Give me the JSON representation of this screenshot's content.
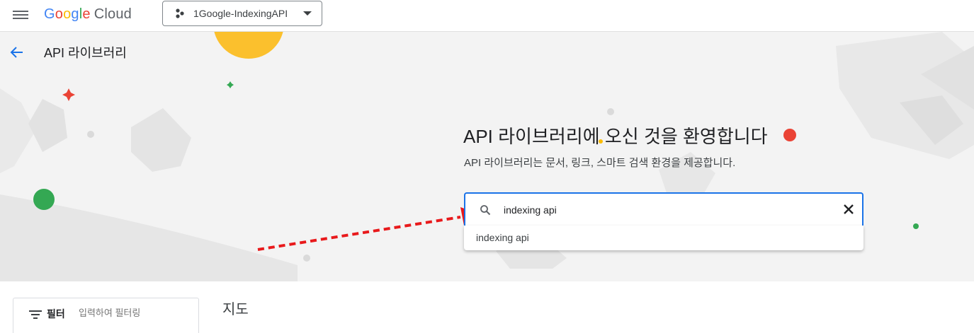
{
  "header": {
    "logo_google": [
      "G",
      "o",
      "o",
      "g",
      "l",
      "e"
    ],
    "logo_cloud": "Cloud",
    "project_name": "1Google-IndexingAPI"
  },
  "hero": {
    "page_title": "API 라이브러리",
    "welcome": "API 라이브러리에 오신 것을 환영합니다",
    "subtitle": "API 라이브러리는 문서, 링크, 스마트 검색 환경을 제공합니다."
  },
  "search": {
    "value": "indexing api",
    "suggestions": [
      "indexing api"
    ]
  },
  "filter": {
    "label": "필터",
    "placeholder": "입력하여 필터링"
  },
  "results": {
    "section_title": "지도"
  },
  "colors": {
    "accent": "#1a73e8",
    "arrow": "#e8191b"
  },
  "icons": [
    "menu-icon",
    "project-dots-icon",
    "dropdown-caret-icon",
    "back-arrow-icon",
    "search-icon",
    "close-icon",
    "filter-icon"
  ]
}
